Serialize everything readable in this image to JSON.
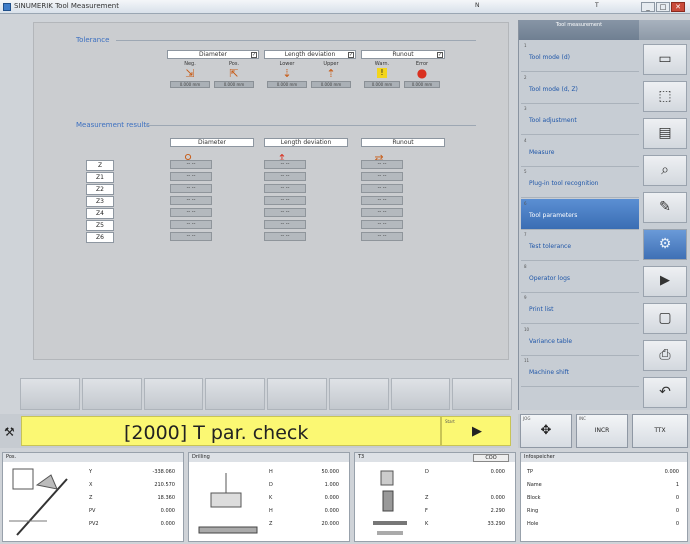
{
  "titlebar": {
    "title": "SINUMERIK Tool Measurement",
    "field1": "N",
    "field2": "T",
    "minimize": "_",
    "maximize": "□",
    "close": "✕"
  },
  "tolerance": {
    "section_label": "Tolerance",
    "groups": [
      {
        "label": "Diameter",
        "chk": "✓",
        "cols": [
          {
            "label": "Neg.",
            "icon": "⇲",
            "value": "0.000 mm"
          },
          {
            "label": "Pos.",
            "icon": "⇱",
            "value": "0.000 mm"
          }
        ]
      },
      {
        "label": "Length deviation",
        "chk": "✓",
        "cols": [
          {
            "label": "Lower",
            "icon": "⇣",
            "value": "0.000 mm"
          },
          {
            "label": "Upper",
            "icon": "⇡",
            "value": "0.000 mm"
          }
        ]
      },
      {
        "label": "Runout",
        "chk": "✓",
        "cols": [
          {
            "label": "Warn.",
            "icon": "!",
            "value": "0.000 mm"
          },
          {
            "label": "Error",
            "icon": "●",
            "value": "0.000 mm"
          }
        ]
      }
    ]
  },
  "results": {
    "section_label": "Measurement results",
    "col_headers": [
      "Diameter",
      "Length deviation",
      "Runout"
    ],
    "rows": [
      "Z",
      "Z1",
      "Z2",
      "Z3",
      "Z4",
      "Z5",
      "Z6"
    ],
    "cell": "-- --"
  },
  "right_panel": {
    "header": "Tool measurement",
    "items": [
      {
        "num": "1",
        "label": "Tool mode (d)"
      },
      {
        "num": "2",
        "label": "Tool mode (d, Z)"
      },
      {
        "num": "3",
        "label": "Tool adjustment"
      },
      {
        "num": "4",
        "label": "Measure"
      },
      {
        "num": "5",
        "label": "Plug-in tool recognition"
      },
      {
        "num": "6",
        "label": "Tool parameters"
      },
      {
        "num": "7",
        "label": "Test tolerance"
      },
      {
        "num": "8",
        "label": "Operator logs"
      },
      {
        "num": "9",
        "label": "Print list"
      },
      {
        "num": "10",
        "label": "Variance table"
      },
      {
        "num": "11",
        "label": "Machine shift"
      }
    ],
    "buttons": [
      "▭",
      "⬚",
      "▤",
      "⌕",
      "✎",
      "⚙",
      "▶",
      "▢",
      "⎙",
      "↶"
    ]
  },
  "status": {
    "message": "[2000] T par. check",
    "start_label": "Start",
    "start_icon": "▶",
    "tool_icon": "⚒"
  },
  "jog": {
    "label1": "JOG",
    "label2": "INC",
    "label3": "",
    "icon1": "✥",
    "text2": "INCR",
    "text3": "TTX"
  },
  "pos_panel": {
    "title": "Pos.",
    "rows": [
      {
        "axis": "Y",
        "val": "-338.060"
      },
      {
        "axis": "X",
        "val": "210.570"
      },
      {
        "axis": "Z",
        "val": "18.360"
      },
      {
        "axis": "PV",
        "val": "0.000"
      },
      {
        "axis": "PV2",
        "val": "0.000"
      }
    ]
  },
  "drilling_panel": {
    "title": "Drilling",
    "rows": [
      {
        "k": "H",
        "v": "50.000"
      },
      {
        "k": "D",
        "v": "1.000"
      },
      {
        "k": "K",
        "v": "0.000"
      },
      {
        "k": "H",
        "v": "0.000"
      },
      {
        "k": "Z",
        "v": "20.000"
      }
    ]
  },
  "t_panel": {
    "title": "T3",
    "badge": "COO",
    "rows": [
      {
        "k": "D",
        "v": "0.000"
      },
      {
        "k": "",
        "v": ""
      },
      {
        "k": "Z",
        "v": "0.000"
      },
      {
        "k": "F",
        "v": "2.290"
      },
      {
        "k": "K",
        "v": "33.290"
      }
    ]
  },
  "info_panel": {
    "title": "Infospeicher",
    "rows": [
      {
        "k": "TP",
        "v": "0.000"
      },
      {
        "k": "Name",
        "v": "1"
      },
      {
        "k": "Block",
        "v": "0"
      },
      {
        "k": "Ring",
        "v": "0"
      },
      {
        "k": "Hole",
        "v": "0"
      }
    ]
  }
}
